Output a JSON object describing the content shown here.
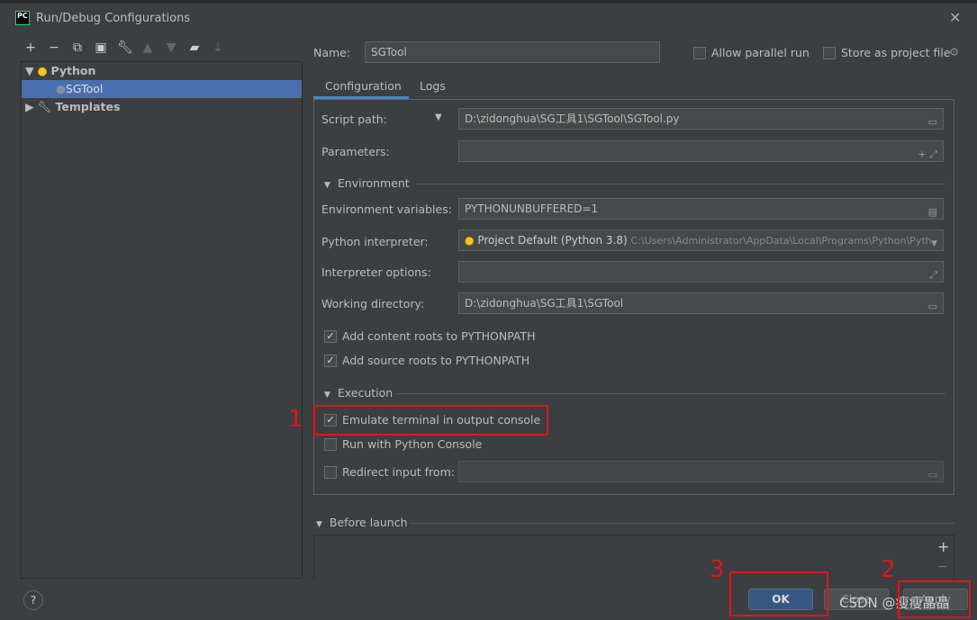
{
  "window": {
    "title": "Run/Debug Configurations",
    "logo": "PC"
  },
  "toolbar": {
    "icons": [
      "plus-icon",
      "minus-icon",
      "copy-icon",
      "save-icon",
      "wrench-icon",
      "arrow-up-icon",
      "arrow-down-icon",
      "new-folder-icon",
      "sort-icon"
    ]
  },
  "tree": {
    "python": "Python",
    "sgtool": "SGTool",
    "templates": "Templates"
  },
  "header": {
    "name_label": "Name:",
    "name_value": "SGTool",
    "allow_parallel": "Allow parallel run",
    "store_project": "Store as project file"
  },
  "tabs": [
    "Configuration",
    "Logs"
  ],
  "config": {
    "script_path_label": "Script path:",
    "script_path": "D:\\zidonghua\\SG工具1\\SGTool\\SGTool.py",
    "parameters_label": "Parameters:",
    "environment": "Environment",
    "env_vars_label": "Environment variables:",
    "env_vars": "PYTHONUNBUFFERED=1",
    "interpreter_label": "Python interpreter:",
    "interpreter": "Project Default (Python 3.8)",
    "interpreter_path": "C:\\Users\\Administrator\\AppData\\Local\\Programs\\Python\\Pyth",
    "interp_options_label": "Interpreter options:",
    "workdir_label": "Working directory:",
    "workdir": "D:\\zidonghua\\SG工具1\\SGTool",
    "content_roots": "Add content roots to PYTHONPATH",
    "source_roots": "Add source roots to PYTHONPATH",
    "execution": "Execution",
    "emulate_terminal": "Emulate terminal in output console",
    "run_python_console": "Run with Python Console",
    "redirect_input": "Redirect input from:"
  },
  "before_launch": "Before launch",
  "buttons": {
    "ok": "OK",
    "cancel": "Close",
    "apply": "Apply",
    "help": "?"
  },
  "annotations": [
    "1",
    "2",
    "3"
  ],
  "watermark": "CSDN @瘦瘦晶晶",
  "colors": {
    "accent": "#4b6eaf",
    "annotation": "#e0141e"
  }
}
